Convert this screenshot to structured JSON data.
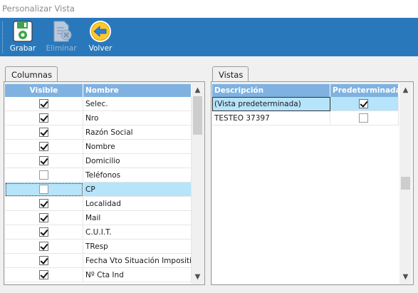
{
  "window": {
    "title": "Personalizar Vista"
  },
  "toolbar": {
    "buttons": [
      {
        "label": "Grabar",
        "icon": "floppy-disk-icon",
        "enabled": true
      },
      {
        "label": "Eliminar",
        "icon": "delete-document-icon",
        "enabled": false
      },
      {
        "label": "Volver",
        "icon": "back-arrow-icon",
        "enabled": true
      }
    ]
  },
  "colors": {
    "toolbar": "#2a78bc",
    "header": "#7fb2e0",
    "selection": "#b6e4fb"
  },
  "columnas": {
    "tab_label": "Columnas",
    "headers": {
      "visible": "Visible",
      "nombre": "Nombre"
    },
    "rows": [
      {
        "visible": true,
        "nombre": "Selec."
      },
      {
        "visible": true,
        "nombre": "Nro"
      },
      {
        "visible": true,
        "nombre": "Razón Social"
      },
      {
        "visible": true,
        "nombre": "Nombre"
      },
      {
        "visible": true,
        "nombre": "Domicilio"
      },
      {
        "visible": false,
        "nombre": "Teléfonos"
      },
      {
        "visible": false,
        "nombre": "CP",
        "selected": true
      },
      {
        "visible": true,
        "nombre": "Localidad"
      },
      {
        "visible": true,
        "nombre": "Mail"
      },
      {
        "visible": true,
        "nombre": "C.U.I.T."
      },
      {
        "visible": true,
        "nombre": "TResp"
      },
      {
        "visible": true,
        "nombre": "Fecha Vto Situación Impositiva"
      },
      {
        "visible": true,
        "nombre": "Nº Cta Ind"
      }
    ]
  },
  "vistas": {
    "tab_label": "Vistas",
    "headers": {
      "descripcion": "Descripción",
      "predeterminada": "Predeterminada"
    },
    "rows": [
      {
        "descripcion": "(Vista predeterminada)",
        "predeterminada": true,
        "selected": true
      },
      {
        "descripcion": "TESTEO 37397",
        "predeterminada": false
      }
    ]
  }
}
